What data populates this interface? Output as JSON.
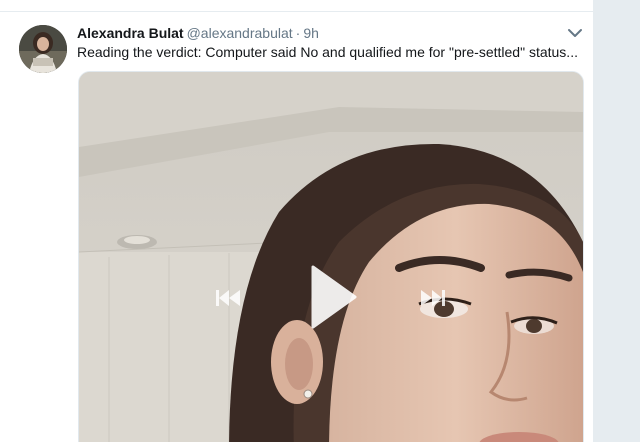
{
  "tweet": {
    "author_name": "Alexandra Bulat",
    "handle": "@alexandrabulat",
    "separator": "·",
    "time": "9h",
    "text": "Reading the verdict: Computer said No and qualified me for \"pre-settled\" status..."
  },
  "video": {
    "controls": {
      "previous": "skip-back-icon",
      "play": "play-icon",
      "next": "skip-forward-icon"
    }
  },
  "colors": {
    "text_primary": "#14171a",
    "text_secondary": "#657786",
    "divider": "#e6ecf0",
    "background": "#e6ecf0"
  }
}
